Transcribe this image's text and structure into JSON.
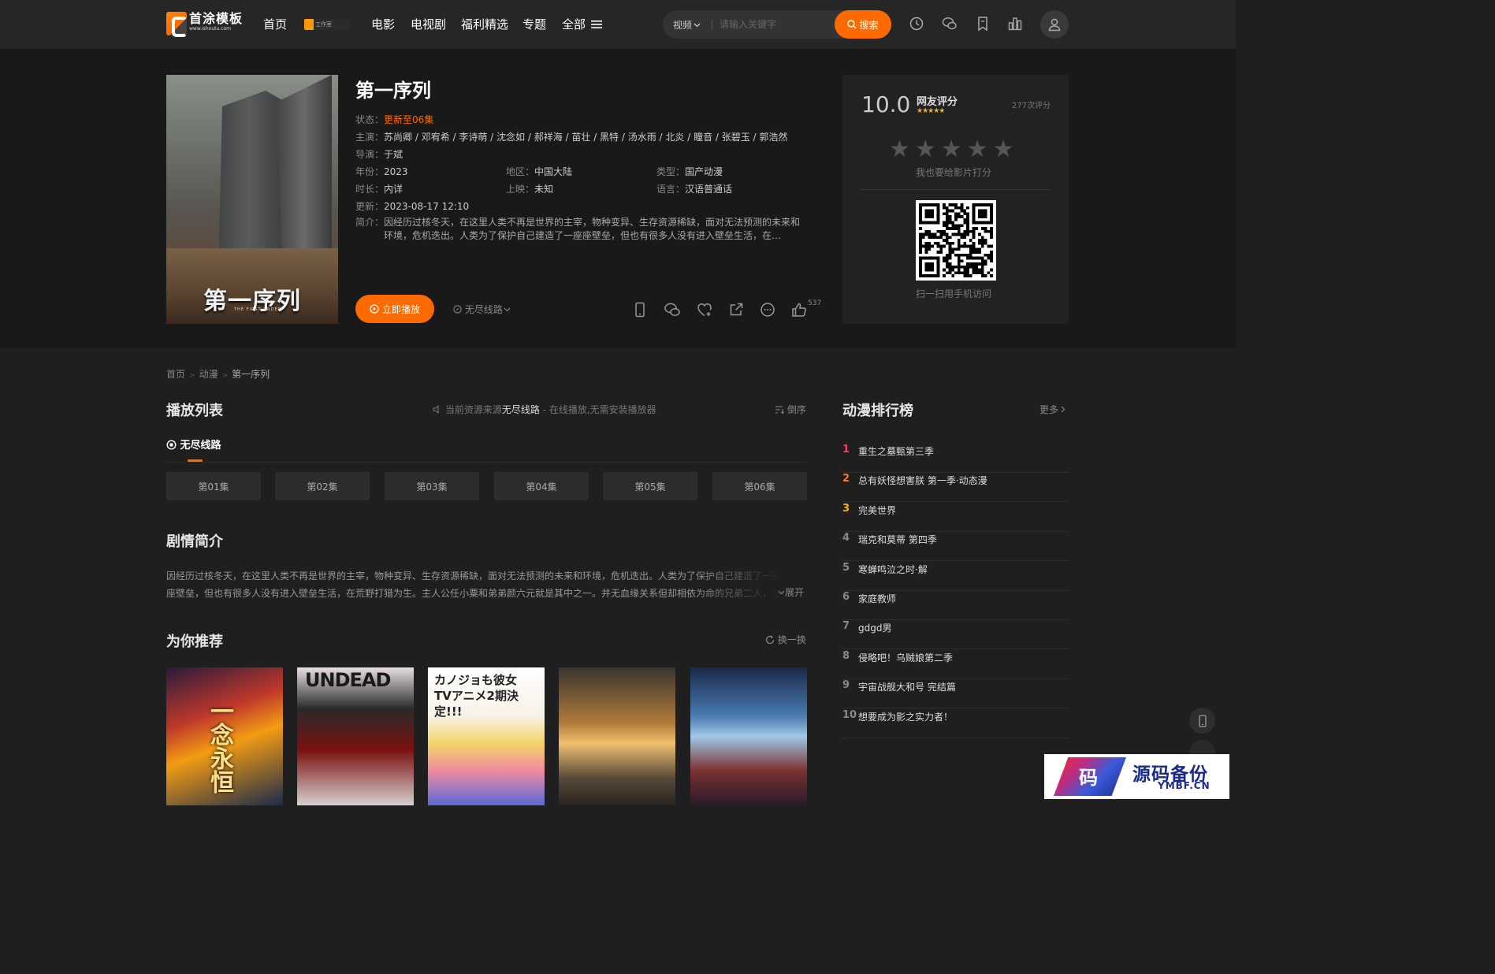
{
  "header": {
    "logo_main": "首涂模板",
    "logo_sub": "www.ishoutu.com",
    "nav": [
      "首页",
      "电影",
      "电视剧",
      "福利精选",
      "专题",
      "全部"
    ],
    "badge": "工作室",
    "search_type": "视频",
    "search_placeholder": "请输入关键字",
    "search_button": "搜索"
  },
  "detail": {
    "title": "第一序列",
    "poster_title": "第一序列",
    "poster_sub": "THE FIRST ORDER",
    "status_label": "状态：",
    "status_value": "更新至06集",
    "cast_label": "主演：",
    "cast_value": "苏尚卿 / 邓宥希 / 李诗萌 / 沈念如 / 郝祥海 / 苗壮 / 黑特 / 汤水雨 / 北炎 / 瞳音 / 张碧玉 / 郭浩然",
    "director_label": "导演：",
    "director_value": "于斌",
    "year_label": "年份：",
    "year_value": "2023",
    "region_label": "地区：",
    "region_value": "中国大陆",
    "genre_label": "类型：",
    "genre_value": "国产动漫",
    "duration_label": "时长：",
    "duration_value": "内详",
    "release_label": "上映：",
    "release_value": "未知",
    "language_label": "语言：",
    "language_value": "汉语普通话",
    "updated_label": "更新：",
    "updated_value": "2023-08-17 12:10",
    "intro_label": "简介：",
    "intro_value": "因经历过核冬天，在这里人类不再是世界的主宰，物种变异、生存资源稀缺，面对无法预测的未来和环境，危机迭出。人类为了保护自己建造了一座座壁垒，但也有很多人没有进入壁垒生活，在…",
    "play_button": "立即播放",
    "source_select": "无尽线路",
    "like_count": "537"
  },
  "rating": {
    "score": "10.0",
    "label": "网友评分",
    "mini_stars": "★★★★★",
    "count": "277次评分",
    "big_stars": "★★★★★",
    "hint": "我也要给影片打分",
    "qr_hint": "扫一扫用手机访问"
  },
  "breadcrumb": [
    "首页",
    "动漫",
    "第一序列"
  ],
  "playlist": {
    "title": "播放列表",
    "note_prefix": "当前资源来源",
    "note_source": "无尽线路",
    "note_suffix": " - 在线播放,无需安装播放器",
    "sort": "倒序",
    "tab": "无尽线路",
    "episodes": [
      "第01集",
      "第02集",
      "第03集",
      "第04集",
      "第05集",
      "第06集"
    ]
  },
  "synopsis": {
    "title": "剧情简介",
    "text": "因经历过核冬天，在这里人类不再是世界的主宰，物种变异、生存资源稀缺，面对无法预测的未来和环境，危机迭出。人类为了保护自己建造了一座座壁垒，但也有很多人没有进入壁垒生活，在荒野打猎为生。主人公任小粟和弟弟颜六元就是其中之一。并无血缘关系但却相依为命的兄弟二人，在荒野中艰难地生存着…",
    "expand": "展开"
  },
  "recommend": {
    "title": "为你推荐",
    "refresh": "换一换",
    "cards": [
      {
        "text": "一念永恒"
      },
      {
        "text": "UNDEAD"
      },
      {
        "text": "カノジョも彼女 TVアニメ2期決定!!!"
      },
      {
        "text": ""
      },
      {
        "text": ""
      }
    ]
  },
  "ranking": {
    "title": "动漫排行榜",
    "more": "更多",
    "colors": [
      "#ff3d5c",
      "#ff7a1a",
      "#ffb400"
    ],
    "items": [
      {
        "num": "1",
        "name": "重生之墓甄第三季"
      },
      {
        "num": "2",
        "name": "总有妖怪想害朕 第一季·动态漫"
      },
      {
        "num": "3",
        "name": "完美世界"
      },
      {
        "num": "4",
        "name": "瑞克和莫蒂 第四季"
      },
      {
        "num": "5",
        "name": "寒蝉鸣泣之时·解"
      },
      {
        "num": "6",
        "name": "家庭教师"
      },
      {
        "num": "7",
        "name": "gdgd男"
      },
      {
        "num": "8",
        "name": "侵略吧！乌贼娘第二季"
      },
      {
        "num": "9",
        "name": "宇宙战舰大和号 完结篇"
      },
      {
        "num": "10",
        "name": "想要成为影之实力者！"
      }
    ]
  },
  "watermark": {
    "mark": "码",
    "main": "源码备份",
    "sub": "YMBF.CN"
  }
}
